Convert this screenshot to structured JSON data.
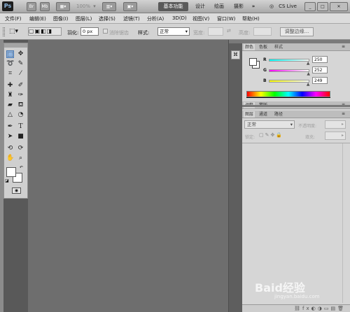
{
  "titlebar": {
    "logo": "Ps",
    "zoom": "100%",
    "workspaces": [
      "基本功能",
      "设计",
      "绘画",
      "摄影"
    ],
    "cs_live": "CS Live",
    "overflow": "»"
  },
  "menubar": {
    "items": [
      "文件(F)",
      "编辑(E)",
      "图像(I)",
      "图层(L)",
      "选择(S)",
      "滤镜(T)",
      "分析(A)",
      "3D(D)",
      "视图(V)",
      "窗口(W)",
      "帮助(H)"
    ]
  },
  "options": {
    "feather_label": "羽化:",
    "feather_value": "0 px",
    "antialias_label": "消除锯齿",
    "style_label": "样式:",
    "style_value": "正常",
    "width_label": "宽度:",
    "height_label": "高度:",
    "refine_label": "调整边缘..."
  },
  "color_panel": {
    "tabs": [
      "颜色",
      "色板",
      "样式"
    ],
    "channels": [
      {
        "label": "R",
        "value": "250",
        "fill": 0.98
      },
      {
        "label": "G",
        "value": "252",
        "fill": 0.99
      },
      {
        "label": "B",
        "value": "249",
        "fill": 0.98
      }
    ]
  },
  "adjust_panel": {
    "tabs": [
      "调整",
      "蒙版"
    ]
  },
  "layers_panel": {
    "tabs": [
      "图层",
      "通道",
      "路径"
    ],
    "blend_mode": "正常",
    "opacity_label": "不透明度:",
    "lock_label": "锁定:",
    "fill_label": "填充:"
  },
  "watermark": {
    "brand": "Baid经验",
    "url": "jingyan.baidu.com"
  }
}
